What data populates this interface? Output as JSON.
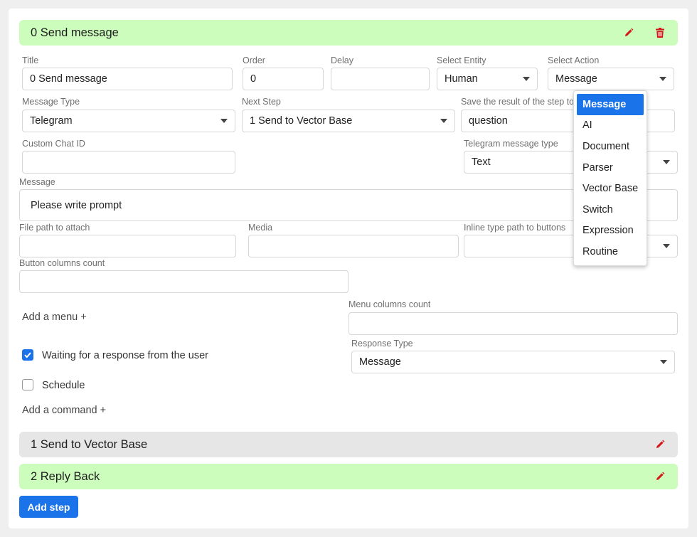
{
  "colors": {
    "accent": "#1a73e8",
    "step_green": "#cdfdbd",
    "step_grey": "#e6e6e6",
    "icon_red": "#d11a1a"
  },
  "step0": {
    "title": "0 Send message"
  },
  "fields": {
    "title": {
      "label": "Title",
      "value": "0 Send message"
    },
    "order": {
      "label": "Order",
      "value": "0"
    },
    "delay": {
      "label": "Delay",
      "value": ""
    },
    "entity": {
      "label": "Select Entity",
      "value": "Human"
    },
    "action": {
      "label": "Select Action",
      "value": "Message"
    },
    "message_type": {
      "label": "Message Type",
      "value": "Telegram"
    },
    "next_step": {
      "label": "Next Step",
      "value": "1 Send to Vector Base"
    },
    "save_result": {
      "label": "Save the result of the step to",
      "value": "question"
    },
    "custom_chat_id": {
      "label": "Custom Chat ID",
      "value": ""
    },
    "tg_msg_type": {
      "label": "Telegram message type",
      "value": "Text"
    },
    "message": {
      "label": "Message",
      "value": "Please write prompt"
    },
    "file_path": {
      "label": "File path to attach",
      "value": ""
    },
    "media": {
      "label": "Media",
      "value": ""
    },
    "inline_path": {
      "label": "Inline type path to buttons",
      "value": ""
    },
    "button_cols": {
      "label": "Button columns count",
      "value": ""
    },
    "menu_cols": {
      "label": "Menu columns count",
      "value": ""
    },
    "response_type": {
      "label": "Response Type",
      "value": "Message"
    }
  },
  "links": {
    "add_menu": "Add a menu +",
    "add_command": "Add a command +"
  },
  "checkboxes": {
    "waiting": "Waiting for a response from the user",
    "schedule": "Schedule"
  },
  "action_menu": [
    "Message",
    "AI",
    "Document",
    "Parser",
    "Vector Base",
    "Switch",
    "Expression",
    "Routine"
  ],
  "step1": {
    "title": "1 Send to Vector Base"
  },
  "step2": {
    "title": "2 Reply Back"
  },
  "add_step": "Add step",
  "icons": {
    "edit": "pencil-icon",
    "delete": "trash-icon",
    "dropdown": "chevron-down-icon",
    "check": "check-icon"
  }
}
